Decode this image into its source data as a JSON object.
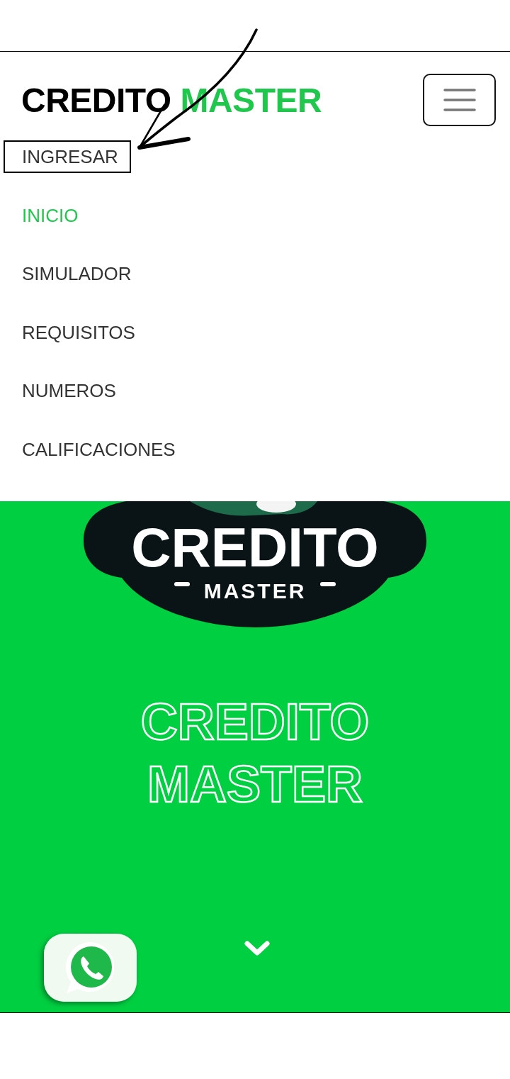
{
  "header": {
    "brand": {
      "text": "CREDITO",
      "accent": "MASTER"
    }
  },
  "nav": [
    {
      "label": "INGRESAR",
      "selected": false,
      "outlined": true
    },
    {
      "label": "INICIO",
      "selected": true,
      "outlined": false
    },
    {
      "label": "SIMULADOR",
      "selected": false,
      "outlined": false
    },
    {
      "label": "REQUISITOS",
      "selected": false,
      "outlined": false
    },
    {
      "label": "NUMEROS",
      "selected": false,
      "outlined": false
    },
    {
      "label": "CALIFICACIONES",
      "selected": false,
      "outlined": false
    }
  ],
  "hero": {
    "logo": {
      "title": "CREDITO",
      "subtitle": "MASTER"
    },
    "heading_lines": [
      "CREDITO",
      "MASTER"
    ]
  }
}
